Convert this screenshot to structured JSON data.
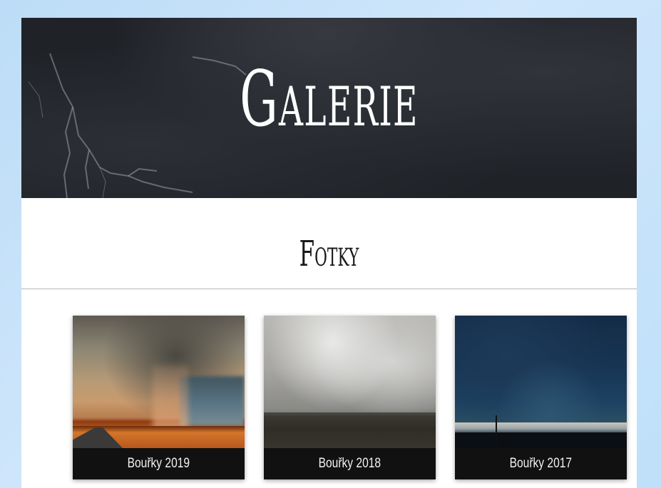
{
  "hero": {
    "title": "Galerie"
  },
  "section": {
    "title": "Fotky"
  },
  "gallery": [
    {
      "caption": "Bouřky 2019"
    },
    {
      "caption": "Bouřky 2018"
    },
    {
      "caption": "Bouřky 2017"
    }
  ],
  "colors": {
    "page_background": "#c6e1f8",
    "hero_background": "#1f2227",
    "caption_background": "#111111",
    "caption_text": "#f2f2f2"
  }
}
